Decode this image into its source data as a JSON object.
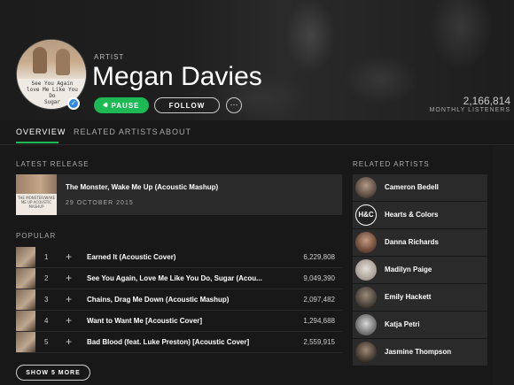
{
  "header": {
    "artist_kind": "ARTIST",
    "artist_name": "Megan Davies",
    "avatar_cover_text": "See You Again\nlove Me Like You Do\nSugar",
    "pause_label": "PAUSE",
    "follow_label": "FOLLOW",
    "more_label": "···",
    "listeners_count": "2,166,814",
    "listeners_label": "MONTHLY LISTENERS"
  },
  "tabs": [
    {
      "label": "OVERVIEW",
      "active": true
    },
    {
      "label": "RELATED ARTISTS",
      "active": false
    },
    {
      "label": "ABOUT",
      "active": false
    }
  ],
  "latest_release": {
    "section_label": "LATEST RELEASE",
    "title": "The Monster, Wake Me Up (Acoustic Mashup)",
    "date": "29 OCTOBER 2015",
    "thumb_text": "THE MONSTER/WAKE ME UP ACOUSTIC MASHUP"
  },
  "popular": {
    "section_label": "POPULAR",
    "tracks": [
      {
        "num": "1",
        "title": "Earned It (Acoustic Cover)",
        "plays": "6,229,808"
      },
      {
        "num": "2",
        "title": "See You Again, Love Me Like You Do, Sugar (Acou...",
        "plays": "9,049,390"
      },
      {
        "num": "3",
        "title": "Chains, Drag Me Down (Acoustic Mashup)",
        "plays": "2,097,482"
      },
      {
        "num": "4",
        "title": "Want to Want Me [Acoustic Cover]",
        "plays": "1,294,688"
      },
      {
        "num": "5",
        "title": "Bad Blood (feat. Luke Preston) [Acoustic Cover]",
        "plays": "2,559,915"
      }
    ],
    "add_label": "+",
    "show_more_label": "SHOW 5 MORE"
  },
  "related_artists": {
    "section_label": "RELATED ARTISTS",
    "items": [
      {
        "name": "Cameron Bedell"
      },
      {
        "name": "Hearts & Colors"
      },
      {
        "name": "Danna Richards"
      },
      {
        "name": "Madilyn Paige"
      },
      {
        "name": "Emily Hackett"
      },
      {
        "name": "Katja Petri"
      },
      {
        "name": "Jasmine Thompson"
      }
    ],
    "hearts_colors_logo_text": "H&C"
  },
  "colors": {
    "accent_green": "#1db954",
    "background": "#181818",
    "row_background": "#2a2a2a",
    "verified_blue": "#2d8ae8"
  }
}
